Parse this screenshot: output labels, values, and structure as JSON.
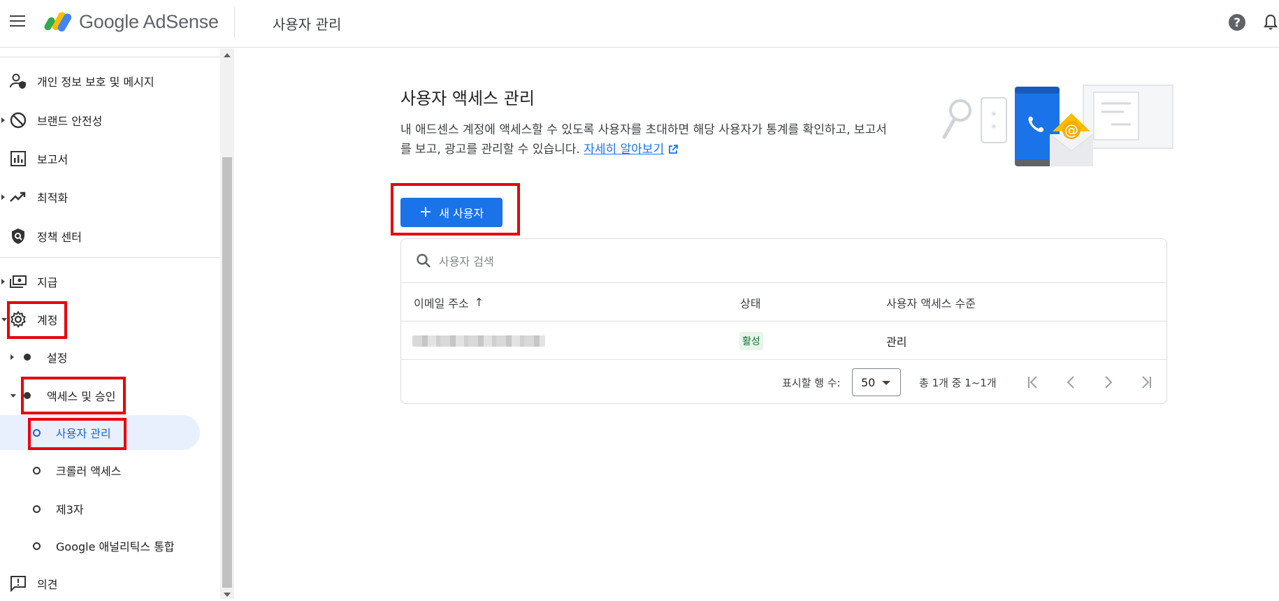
{
  "header": {
    "brand": "Google AdSense",
    "page_title": "사용자 관리"
  },
  "sidebar": {
    "items": [
      {
        "label": "개인 정보 보호 및 메시지",
        "icon": "person-shield-icon"
      },
      {
        "label": "브랜드 안전성",
        "icon": "block-icon"
      },
      {
        "label": "보고서",
        "icon": "bar-chart-icon"
      },
      {
        "label": "최적화",
        "icon": "trending-up-icon"
      },
      {
        "label": "정책 센터",
        "icon": "policy-shield-icon"
      },
      {
        "label": "지급",
        "icon": "payments-icon"
      },
      {
        "label": "계정",
        "icon": "gear-icon"
      }
    ],
    "sub_items": [
      {
        "label": "설정"
      },
      {
        "label": "액세스 및 승인"
      }
    ],
    "sub_sub_items": [
      {
        "label": "사용자 관리"
      },
      {
        "label": "크롤러 액세스"
      },
      {
        "label": "제3자"
      },
      {
        "label": "Google 애널리틱스 통합"
      }
    ],
    "feedback": {
      "label": "의견",
      "icon": "feedback-icon"
    }
  },
  "main": {
    "title": "사용자 액세스 관리",
    "description": "내 애드센스 계정에 액세스할 수 있도록 사용자를 초대하면 해당 사용자가 통계를 확인하고, 보고서를 보고, 광고를 관리할 수 있습니다.",
    "learn_more": "자세히 알아보기",
    "new_user_button": "새 사용자",
    "search_placeholder": "사용자 검색",
    "columns": {
      "email": "이메일 주소",
      "status": "상태",
      "access_level": "사용자 액세스 수준"
    },
    "rows": [
      {
        "status": "활성",
        "access_level": "관리"
      }
    ],
    "pagination": {
      "rows_label": "표시할 행 수:",
      "rows_value": "50",
      "range": "총 1개 중 1~1개"
    }
  },
  "colors": {
    "accent": "#1a73e8",
    "active_bg": "#e8f0fe",
    "highlight": "#e8000b",
    "status_active": "#137333"
  }
}
